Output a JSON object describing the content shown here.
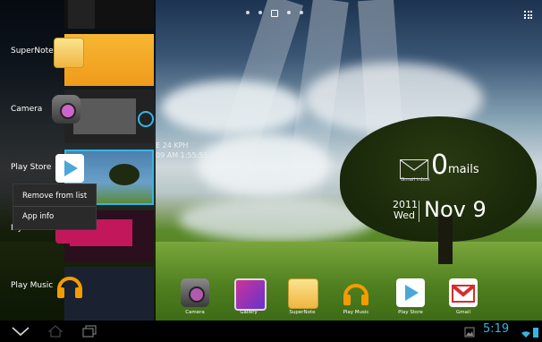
{
  "recents": {
    "items": [
      {
        "label": "SuperNote"
      },
      {
        "label": "Camera"
      },
      {
        "label": "Play Store"
      },
      {
        "label": "MyCloud"
      },
      {
        "label": "Play Music"
      }
    ]
  },
  "context_menu": {
    "items": [
      {
        "label": "Remove from list"
      },
      {
        "label": "App info"
      }
    ]
  },
  "widget": {
    "speed_line1": "E 24 KPH",
    "speed_line2": "09 AM 1:55:51",
    "mail_count": "0",
    "mail_label": "mails",
    "mail_sub": "Gmail inbox",
    "year": "2011",
    "weekday": "Wed",
    "date": "Nov 9"
  },
  "dock": {
    "items": [
      {
        "label": "Camera",
        "icon": "camera-icon"
      },
      {
        "label": "Gallery",
        "icon": "gallery-icon"
      },
      {
        "label": "SuperNote",
        "icon": "supernote-icon"
      },
      {
        "label": "Play Music",
        "icon": "headphones-icon"
      },
      {
        "label": "Play Store",
        "icon": "play-store-icon"
      },
      {
        "label": "Gmail",
        "icon": "gmail-icon"
      }
    ]
  },
  "status": {
    "time": "5:19"
  },
  "colors": {
    "accent": "#33b5e5",
    "selection": "#33b5e5"
  }
}
